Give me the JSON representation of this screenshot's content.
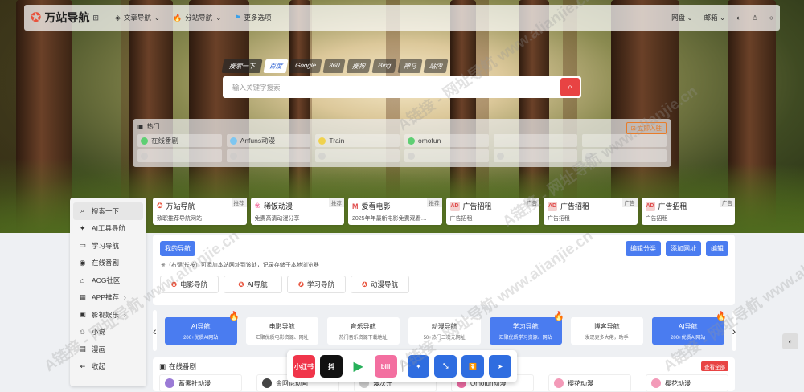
{
  "header": {
    "brand": "万站导航",
    "nav": [
      {
        "icon": "layers-icon",
        "label": "文章导航"
      },
      {
        "icon": "fire-icon",
        "label": "分站导航"
      },
      {
        "icon": "flag-icon",
        "label": "更多选项"
      }
    ],
    "right": [
      "网盘",
      "邮箱"
    ]
  },
  "search": {
    "tabs": [
      "搜索一下",
      "百度",
      "Google",
      "360",
      "搜狗",
      "Bing",
      "神马",
      "站内"
    ],
    "active": 1,
    "placeholder": "输入关键字搜索"
  },
  "hot": {
    "title": "热门",
    "cta": "立即入驻",
    "items": [
      {
        "label": "在线番剧",
        "color": "#5fcf73"
      },
      {
        "label": "Anfuns动漫",
        "color": "#7ec6f0"
      },
      {
        "label": "Train",
        "color": "#f0d24e"
      },
      {
        "label": "omofun",
        "color": "#5fcf73"
      },
      {
        "label": "",
        "color": "transparent"
      },
      {
        "label": "",
        "color": "transparent"
      }
    ]
  },
  "sidebar": [
    {
      "icon": "search-icon",
      "label": "搜索一下"
    },
    {
      "icon": "ai-icon",
      "label": "AI工具导航"
    },
    {
      "icon": "folder-icon",
      "label": "学习导航"
    },
    {
      "icon": "tv-icon",
      "label": "在线番剧"
    },
    {
      "icon": "home-icon",
      "label": "ACG社区"
    },
    {
      "icon": "app-icon",
      "label": "APP推荐"
    },
    {
      "icon": "movie-icon",
      "label": "影视娱乐"
    },
    {
      "icon": "book-icon",
      "label": "小说"
    },
    {
      "icon": "comic-icon",
      "label": "漫画"
    },
    {
      "icon": "collapse-icon",
      "label": "收起"
    }
  ],
  "cards": [
    {
      "title": "万站导航",
      "desc": "致职推荐导航网站",
      "badge": "推荐"
    },
    {
      "title": "稀饭动漫",
      "desc": "免费高清动漫分享",
      "badge": "推荐"
    },
    {
      "title": "爱看电影",
      "desc": "2025年年最新电影免费观看…",
      "badge": "推荐"
    },
    {
      "title": "广告招租",
      "desc": "广告招租",
      "badge": "广告"
    },
    {
      "title": "广告招租",
      "desc": "广告招租",
      "badge": "广告"
    },
    {
      "title": "广告招租",
      "desc": "广告招租",
      "badge": "广告"
    }
  ],
  "mynav": {
    "title": "我的导航",
    "buttons": [
      "编辑分类",
      "添加网址",
      "编辑"
    ],
    "hint": "※（右键/长按）可添加本站网址到该处，记录存储于本地浏览器",
    "items": [
      "电影导航",
      "AI导航",
      "学习导航",
      "动漫导航"
    ]
  },
  "carousel": [
    {
      "title": "AI导航",
      "desc": "200+优质AI网站",
      "hot": true
    },
    {
      "title": "电影导航",
      "desc": "汇聚优质电影资源、网址",
      "hot": false
    },
    {
      "title": "音乐导航",
      "desc": "热门音乐资源下载地址",
      "hot": false
    },
    {
      "title": "动漫导航",
      "desc": "50+热门二次元网址",
      "hot": false
    },
    {
      "title": "学习导航",
      "desc": "汇聚优质学习资源、网站",
      "hot": true
    },
    {
      "title": "博客导航",
      "desc": "发现更多大佬，助手",
      "hot": false
    },
    {
      "title": "AI导航",
      "desc": "200+优质AI网站",
      "hot": true
    }
  ],
  "section": {
    "title": "在线番剧",
    "more": "查看全部",
    "items": [
      "蓄素社动漫",
      "金阿尼动画",
      "漫次元",
      "Omofun动漫",
      "樱花动漫",
      "樱花动漫"
    ]
  },
  "dock": [
    {
      "label": "小红书",
      "bg": "#f0354a"
    },
    {
      "label": "抖",
      "bg": "#111"
    },
    {
      "label": "▶",
      "bg": "#fff"
    },
    {
      "label": "bili",
      "bg": "#f36fa0"
    },
    {
      "label": "✦",
      "bg": "#2f6de0"
    },
    {
      "label": "⤡",
      "bg": "#2f6de0"
    },
    {
      "label": "⏬",
      "bg": "#2f6de0"
    },
    {
      "label": "➤",
      "bg": "#2f6de0"
    }
  ],
  "watermark": "A链接 - 网址导航 www.alianjie.cn"
}
